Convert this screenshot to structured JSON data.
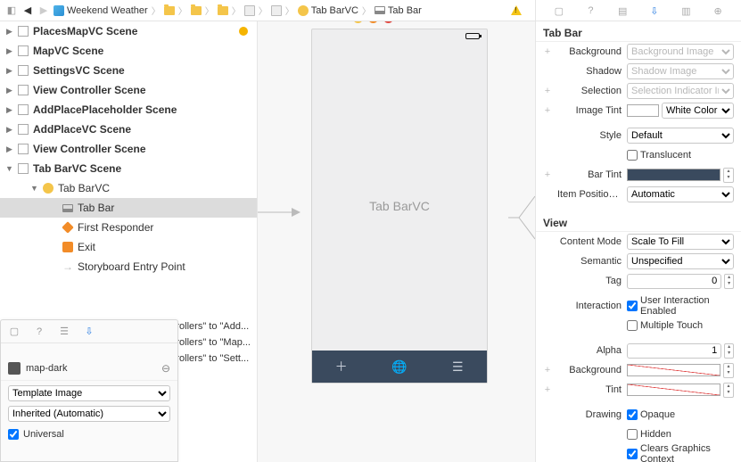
{
  "breadcrumb": {
    "project": "Weekend Weather",
    "tabvc": "Tab BarVC",
    "tabbar": "Tab Bar"
  },
  "outline": {
    "scenes": [
      {
        "label": "PlacesMapVC Scene",
        "status": true
      },
      {
        "label": "MapVC Scene"
      },
      {
        "label": "SettingsVC Scene"
      },
      {
        "label": "View Controller Scene"
      },
      {
        "label": "AddPlacePlaceholder Scene"
      },
      {
        "label": "AddPlaceVC Scene"
      },
      {
        "label": "View Controller Scene"
      }
    ],
    "open_scene": "Tab BarVC Scene",
    "open_children": [
      {
        "label": "Tab BarVC",
        "icon": "tabvc",
        "disc": "▼"
      },
      {
        "label": "Tab Bar",
        "icon": "tabbar",
        "selected": true,
        "disc": ""
      },
      {
        "label": "First Responder",
        "icon": "fr",
        "disc": ""
      },
      {
        "label": "Exit",
        "icon": "exit",
        "disc": ""
      },
      {
        "label": "Storyboard Entry Point",
        "icon": "arrow",
        "disc": ""
      }
    ],
    "segues": [
      "rollers\" to \"Add...",
      "rollers\" to \"Map...",
      "rollers\" to \"Sett..."
    ]
  },
  "medialib": {
    "item": "map-dark",
    "render": "Template Image",
    "appearance": "Inherited (Automatic)",
    "universal": "Universal"
  },
  "canvas": {
    "vc_title": "Tab BarVC"
  },
  "inspector": {
    "sect_tabbar": "Tab Bar",
    "background_label": "Background",
    "background_ph": "Background Image",
    "shadow_label": "Shadow",
    "shadow_ph": "Shadow Image",
    "selection_label": "Selection",
    "selection_ph": "Selection Indicator Image",
    "imagetint_label": "Image Tint",
    "imagetint_val": "White Color",
    "style_label": "Style",
    "style_val": "Default",
    "translucent": "Translucent",
    "bartint_label": "Bar Tint",
    "itempos_label": "Item Positioni...",
    "itempos_val": "Automatic",
    "sect_view": "View",
    "contentmode_label": "Content Mode",
    "contentmode_val": "Scale To Fill",
    "semantic_label": "Semantic",
    "semantic_val": "Unspecified",
    "tag_label": "Tag",
    "tag_val": "0",
    "interaction_label": "Interaction",
    "uie": "User Interaction Enabled",
    "mtouch": "Multiple Touch",
    "alpha_label": "Alpha",
    "alpha_val": "1",
    "bg_label": "Background",
    "tint_label": "Tint",
    "drawing_label": "Drawing",
    "opaque": "Opaque",
    "hidden": "Hidden",
    "clears": "Clears Graphics Context"
  }
}
